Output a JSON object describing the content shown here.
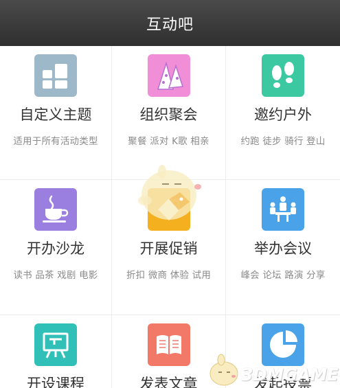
{
  "header": {
    "title": "互动吧"
  },
  "items": [
    {
      "title": "自定义主题",
      "subtitle": "适用于所有活动类型",
      "icon": "grid-icon",
      "color": "#9db8c8"
    },
    {
      "title": "组织聚会",
      "subtitle": "聚餐 派对 K歌 相亲",
      "icon": "party-hat-icon",
      "color": "#f08fd8"
    },
    {
      "title": "邀约户外",
      "subtitle": "约跑 徒步 骑行 登山",
      "icon": "footprints-icon",
      "color": "#3cc8a0"
    },
    {
      "title": "开办沙龙",
      "subtitle": "读书 品茶 戏剧 电影",
      "icon": "coffee-cup-icon",
      "color": "#9b7fe0"
    },
    {
      "title": "开展促销",
      "subtitle": "折扣 微商 体验 试用",
      "icon": "price-tag-icon",
      "color": "#f5b020"
    },
    {
      "title": "举办会议",
      "subtitle": "峰会 论坛 路演 分享",
      "icon": "meeting-icon",
      "color": "#4aa3e8"
    },
    {
      "title": "开设课程",
      "subtitle": "",
      "icon": "easel-icon",
      "color": "#30c0b8"
    },
    {
      "title": "发表文章",
      "subtitle": "",
      "icon": "book-icon",
      "color": "#f27868"
    },
    {
      "title": "发起投票",
      "subtitle": "",
      "icon": "pie-chart-icon",
      "color": "#4aa3e8"
    }
  ],
  "watermark": {
    "text": "3DMGAME"
  }
}
